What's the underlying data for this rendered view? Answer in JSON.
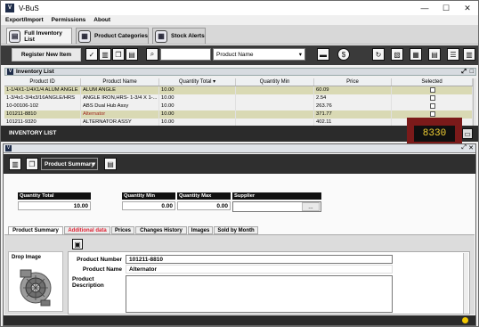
{
  "window": {
    "app_icon": "V",
    "title": "V-BuS",
    "minimize": "—",
    "maximize": "☐",
    "close": "✕"
  },
  "menu": [
    "Export/Import",
    "Permissions",
    "About"
  ],
  "tabs": [
    {
      "label": "Full Inventory List",
      "icon": "inventory-icon"
    },
    {
      "label": "Product Categories",
      "icon": "categories-icon"
    },
    {
      "label": "Stock Alerts",
      "icon": "alerts-icon"
    }
  ],
  "toolbar": {
    "register_label": "Register New Item",
    "search_value": "",
    "search_field_select": "Product Name"
  },
  "inventory": {
    "title": "Inventory List",
    "columns": [
      "Product ID",
      "Product Name",
      "Quantity Total",
      "Quantity Min",
      "Price",
      "Selected"
    ],
    "rows": [
      {
        "id": "1-1/4X1-1/4X1/4 ALUM ANGLE",
        "name": "ALUM ANGLE",
        "qty": "10.00",
        "min": "",
        "price": "60.09"
      },
      {
        "id": "1-3/4x1-3/4x3/16ANGLE/HRS",
        "name": "ANGLE IRON,HRS- 1-3/4 X 1-...",
        "qty": "10.00",
        "min": "",
        "price": "2.54"
      },
      {
        "id": "10-00106-102",
        "name": "ABS Dual Hub Assy",
        "qty": "10.00",
        "min": "",
        "price": "263.76"
      },
      {
        "id": "101211-8810",
        "name": "Alternator",
        "qty": "10.00",
        "min": "",
        "price": "371.77"
      },
      {
        "id": "101211-9320",
        "name": "ALTERNATOR ASSY",
        "qty": "10.00",
        "min": "",
        "price": "402.11"
      }
    ],
    "footer_label": "INVENTORY LIST",
    "count": "8330"
  },
  "summary": {
    "select_label": "Product Summary",
    "quantity_total_label": "Quantity Total",
    "quantity_total": "10.00",
    "quantity_min_label": "Quantity Min",
    "quantity_min": "0.00",
    "quantity_max_label": "Quantity Max",
    "quantity_max": "0.00",
    "supplier_label": "Supplier",
    "supplier_button": "...",
    "subtabs": [
      "Product Summary",
      "Additional data",
      "Prices",
      "Changes History",
      "Images",
      "Sold by Month"
    ],
    "drop_image": "Drop Image",
    "product_number_label": "Product Number",
    "product_number": "101211-8810",
    "product_name_label": "Product Name",
    "product_name": "Alternator",
    "product_description_label": "Product Description"
  },
  "colors": {
    "count_border": "#7b1a1a",
    "count_text": "#f2d033",
    "row_highlight": "#d9d9b4",
    "warn_tab": "#d22233"
  }
}
